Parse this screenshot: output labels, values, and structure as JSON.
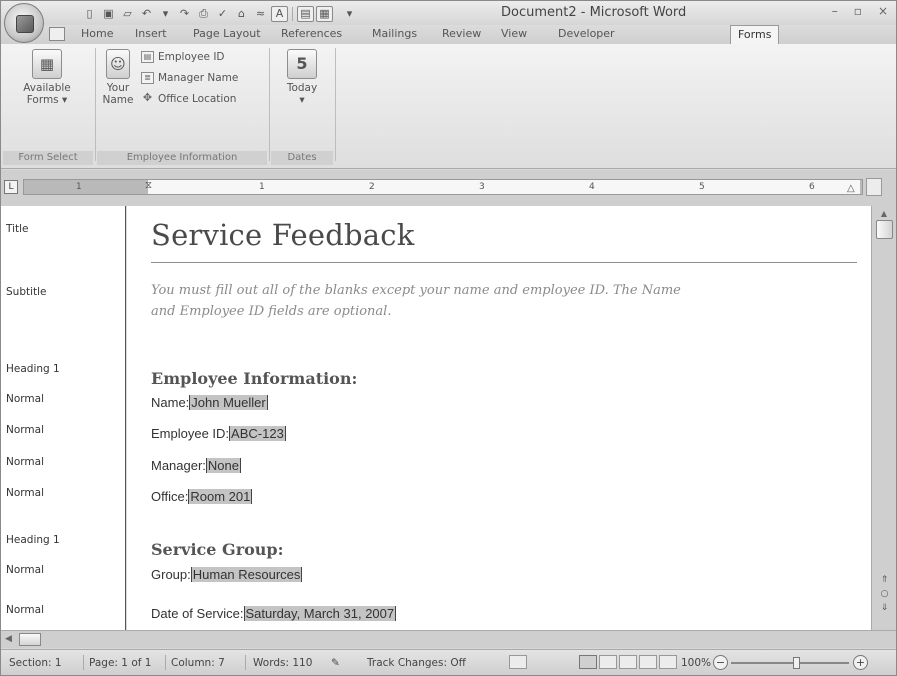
{
  "window": {
    "title": "Document2 - Microsoft Word",
    "controls": {
      "minimize": "–",
      "restore": "▫",
      "close": "×"
    }
  },
  "quick_access": {
    "undo_icon": "↶",
    "redo_icon": "↷",
    "dropdown": "▾"
  },
  "ribbon": {
    "tabs": [
      "Home",
      "Insert",
      "Page Layout",
      "References",
      "Mailings",
      "Review",
      "View",
      "Developer",
      "Forms"
    ],
    "active_tab": "Forms",
    "groups": {
      "form_select": {
        "label": "Form Select",
        "available_forms": {
          "line1": "Available",
          "line2": "Forms ▾"
        }
      },
      "employee_information": {
        "label": "Employee Information",
        "your_name": {
          "line1": "Your",
          "line2": "Name"
        },
        "employee_id": "Employee ID",
        "manager_name": "Manager Name",
        "office_location": "Office Location"
      },
      "dates": {
        "label": "Dates",
        "today": "Today",
        "today_icon_text": "5",
        "dropdown": "▾"
      }
    }
  },
  "ruler": {
    "tab_selector": "L",
    "numbers": [
      "1",
      "1",
      "2",
      "3",
      "4",
      "5",
      "6"
    ]
  },
  "style_pane": {
    "items": [
      "Title",
      "Subtitle",
      "Heading 1",
      "Normal",
      "Normal",
      "Normal",
      "Normal",
      "Heading 1",
      "Normal",
      "Normal"
    ]
  },
  "document": {
    "title": "Service Feedback",
    "subtitle_line1": "You must fill out all of the blanks except your name and employee ID. The Name",
    "subtitle_line2": "and Employee ID fields are optional.",
    "section1": {
      "heading": "Employee Information:",
      "fields": [
        {
          "label": "Name:",
          "value": "John Mueller"
        },
        {
          "label": "Employee ID:",
          "value": "ABC-123"
        },
        {
          "label": "Manager:",
          "value": "None"
        },
        {
          "label": "Office:",
          "value": "Room 201"
        }
      ]
    },
    "section2": {
      "heading": "Service Group:",
      "fields": [
        {
          "label": "Group:",
          "value": "Human Resources"
        },
        {
          "label": "Date of Service:",
          "value": "Saturday, March 31, 2007"
        }
      ]
    }
  },
  "status_bar": {
    "section": "Section: 1",
    "page": "Page: 1 of 1",
    "column": "Column: 7",
    "words": "Words: 110",
    "track_changes": "Track Changes: Off",
    "zoom": "100%",
    "zoom_minus": "−",
    "zoom_plus": "+"
  }
}
